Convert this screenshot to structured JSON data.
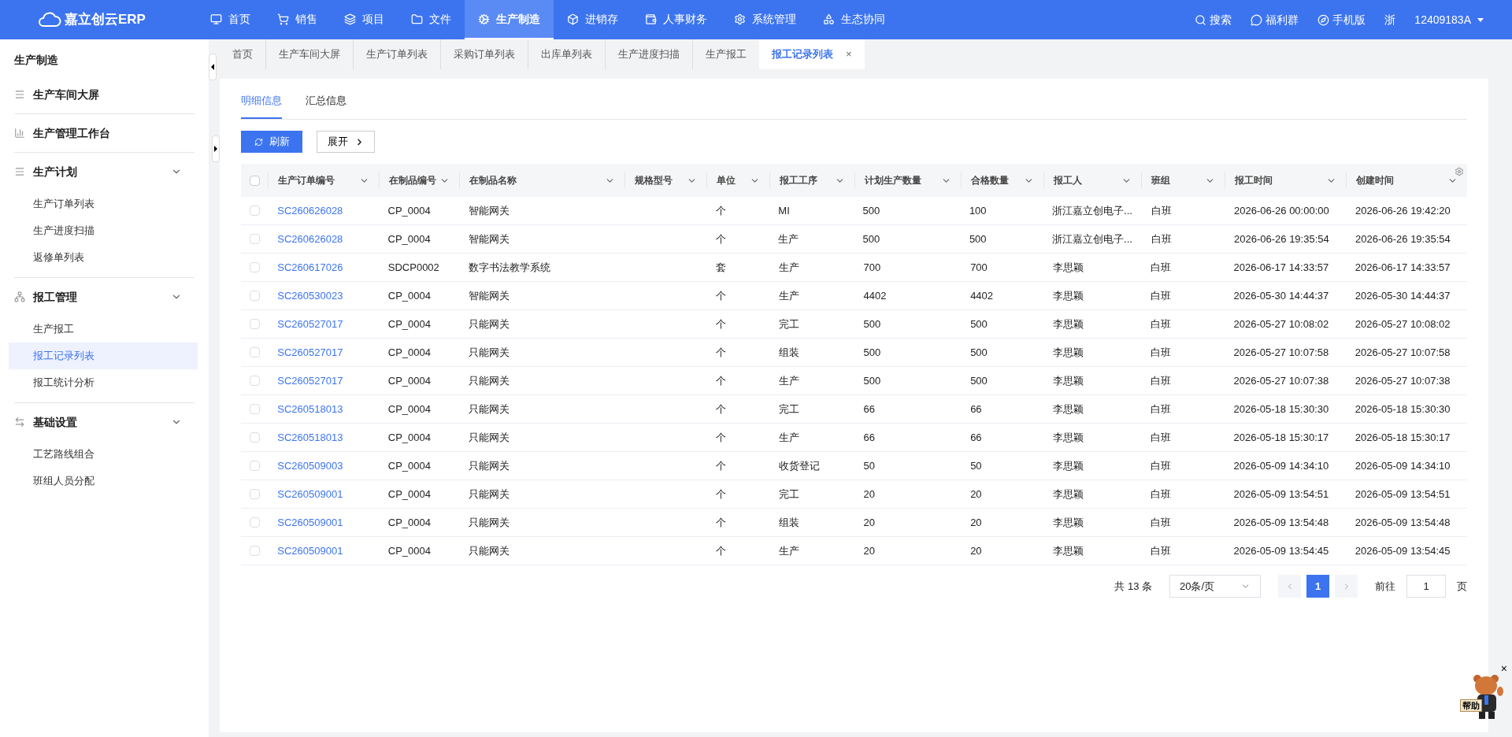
{
  "topbar": {
    "logo": "嘉立创云ERP",
    "nav": [
      {
        "label": "首页",
        "selected": false
      },
      {
        "label": "销售",
        "selected": false
      },
      {
        "label": "项目",
        "selected": false
      },
      {
        "label": "文件",
        "selected": false
      },
      {
        "label": "生产制造",
        "selected": true
      },
      {
        "label": "进销存",
        "selected": false
      },
      {
        "label": "人事财务",
        "selected": false
      },
      {
        "label": "系统管理",
        "selected": false
      },
      {
        "label": "生态协同",
        "selected": false
      }
    ],
    "actions": [
      "搜索",
      "福利群",
      "手机版"
    ],
    "region": "浙",
    "user": "12409183A"
  },
  "sidebar": {
    "title": "生产制造",
    "groups": [
      {
        "label": "生产车间大屏"
      },
      {
        "label": "生产管理工作台"
      },
      {
        "label": "生产计划",
        "expanded": true,
        "children": [
          {
            "label": "生产订单列表",
            "selected": false
          },
          {
            "label": "生产进度扫描",
            "selected": false
          },
          {
            "label": "返修单列表",
            "selected": false
          }
        ]
      },
      {
        "label": "报工管理",
        "expanded": true,
        "children": [
          {
            "label": "生产报工",
            "selected": false
          },
          {
            "label": "报工记录列表",
            "selected": true
          },
          {
            "label": "报工统计分析",
            "selected": false
          }
        ]
      },
      {
        "label": "基础设置",
        "expanded": true,
        "children": [
          {
            "label": "工艺路线组合",
            "selected": false
          },
          {
            "label": "班组人员分配",
            "selected": false
          }
        ]
      }
    ]
  },
  "page_tabs": [
    {
      "label": "首页",
      "selected": false
    },
    {
      "label": "生产车间大屏",
      "selected": false
    },
    {
      "label": "生产订单列表",
      "selected": false
    },
    {
      "label": "采购订单列表",
      "selected": false
    },
    {
      "label": "出库单列表",
      "selected": false
    },
    {
      "label": "生产进度扫描",
      "selected": false
    },
    {
      "label": "生产报工",
      "selected": false
    },
    {
      "label": "报工记录列表",
      "selected": true,
      "close": "×"
    }
  ],
  "sub_tabs": [
    {
      "label": "明细信息",
      "selected": true
    },
    {
      "label": "汇总信息",
      "selected": false
    }
  ],
  "toolbar": {
    "refresh": "刷新",
    "expand": "展开"
  },
  "table": {
    "all_checked": false,
    "columns": [
      "生产订单编号",
      "在制品编号",
      "在制品名称",
      "规格型号",
      "单位",
      "报工工序",
      "计划生产数量",
      "合格数量",
      "报工人",
      "班组",
      "报工时间",
      "创建时间"
    ],
    "rows": [
      {
        "checked": false,
        "cells": [
          "SC260626028",
          "CP_0004",
          "智能网关",
          "",
          "个",
          "MI",
          "500",
          "100",
          "浙江嘉立创电子...",
          "白班",
          "2026-06-26 00:00:00",
          "2026-06-26 19:42:20"
        ]
      },
      {
        "checked": false,
        "cells": [
          "SC260626028",
          "CP_0004",
          "智能网关",
          "",
          "个",
          "生产",
          "500",
          "500",
          "浙江嘉立创电子...",
          "白班",
          "2026-06-26 19:35:54",
          "2026-06-26 19:35:54"
        ]
      },
      {
        "checked": false,
        "cells": [
          "SC260617026",
          "SDCP0002",
          "数字书法教学系统",
          "",
          "套",
          "生产",
          "700",
          "700",
          "李思颖",
          "白班",
          "2026-06-17 14:33:57",
          "2026-06-17 14:33:57"
        ]
      },
      {
        "checked": false,
        "cells": [
          "SC260530023",
          "CP_0004",
          "智能网关",
          "",
          "个",
          "生产",
          "4402",
          "4402",
          "李思颖",
          "白班",
          "2026-05-30 14:44:37",
          "2026-05-30 14:44:37"
        ]
      },
      {
        "checked": false,
        "cells": [
          "SC260527017",
          "CP_0004",
          "只能网关",
          "",
          "个",
          "完工",
          "500",
          "500",
          "李思颖",
          "白班",
          "2026-05-27 10:08:02",
          "2026-05-27 10:08:02"
        ]
      },
      {
        "checked": false,
        "cells": [
          "SC260527017",
          "CP_0004",
          "只能网关",
          "",
          "个",
          "组装",
          "500",
          "500",
          "李思颖",
          "白班",
          "2026-05-27 10:07:58",
          "2026-05-27 10:07:58"
        ]
      },
      {
        "checked": false,
        "cells": [
          "SC260527017",
          "CP_0004",
          "只能网关",
          "",
          "个",
          "生产",
          "500",
          "500",
          "李思颖",
          "白班",
          "2026-05-27 10:07:38",
          "2026-05-27 10:07:38"
        ]
      },
      {
        "checked": false,
        "cells": [
          "SC260518013",
          "CP_0004",
          "只能网关",
          "",
          "个",
          "完工",
          "66",
          "66",
          "李思颖",
          "白班",
          "2026-05-18 15:30:30",
          "2026-05-18 15:30:30"
        ]
      },
      {
        "checked": false,
        "cells": [
          "SC260518013",
          "CP_0004",
          "只能网关",
          "",
          "个",
          "生产",
          "66",
          "66",
          "李思颖",
          "白班",
          "2026-05-18 15:30:17",
          "2026-05-18 15:30:17"
        ]
      },
      {
        "checked": false,
        "cells": [
          "SC260509003",
          "CP_0004",
          "只能网关",
          "",
          "个",
          "收货登记",
          "50",
          "50",
          "李思颖",
          "白班",
          "2026-05-09 14:34:10",
          "2026-05-09 14:34:10"
        ]
      },
      {
        "checked": false,
        "cells": [
          "SC260509001",
          "CP_0004",
          "只能网关",
          "",
          "个",
          "完工",
          "20",
          "20",
          "李思颖",
          "白班",
          "2026-05-09 13:54:51",
          "2026-05-09 13:54:51"
        ]
      },
      {
        "checked": false,
        "cells": [
          "SC260509001",
          "CP_0004",
          "只能网关",
          "",
          "个",
          "组装",
          "20",
          "20",
          "李思颖",
          "白班",
          "2026-05-09 13:54:48",
          "2026-05-09 13:54:48"
        ]
      },
      {
        "checked": false,
        "cells": [
          "SC260509001",
          "CP_0004",
          "只能网关",
          "",
          "个",
          "生产",
          "20",
          "20",
          "李思颖",
          "白班",
          "2026-05-09 13:54:45",
          "2026-05-09 13:54:45"
        ]
      }
    ]
  },
  "pagination": {
    "total": "共 13 条",
    "page_size": "20条/页",
    "pages": [
      {
        "label": "1",
        "selected": true
      }
    ],
    "goto_label": "前往",
    "goto_value": "1",
    "goto_suffix": "页"
  },
  "helper": {
    "sign": "帮助",
    "close": "×"
  }
}
